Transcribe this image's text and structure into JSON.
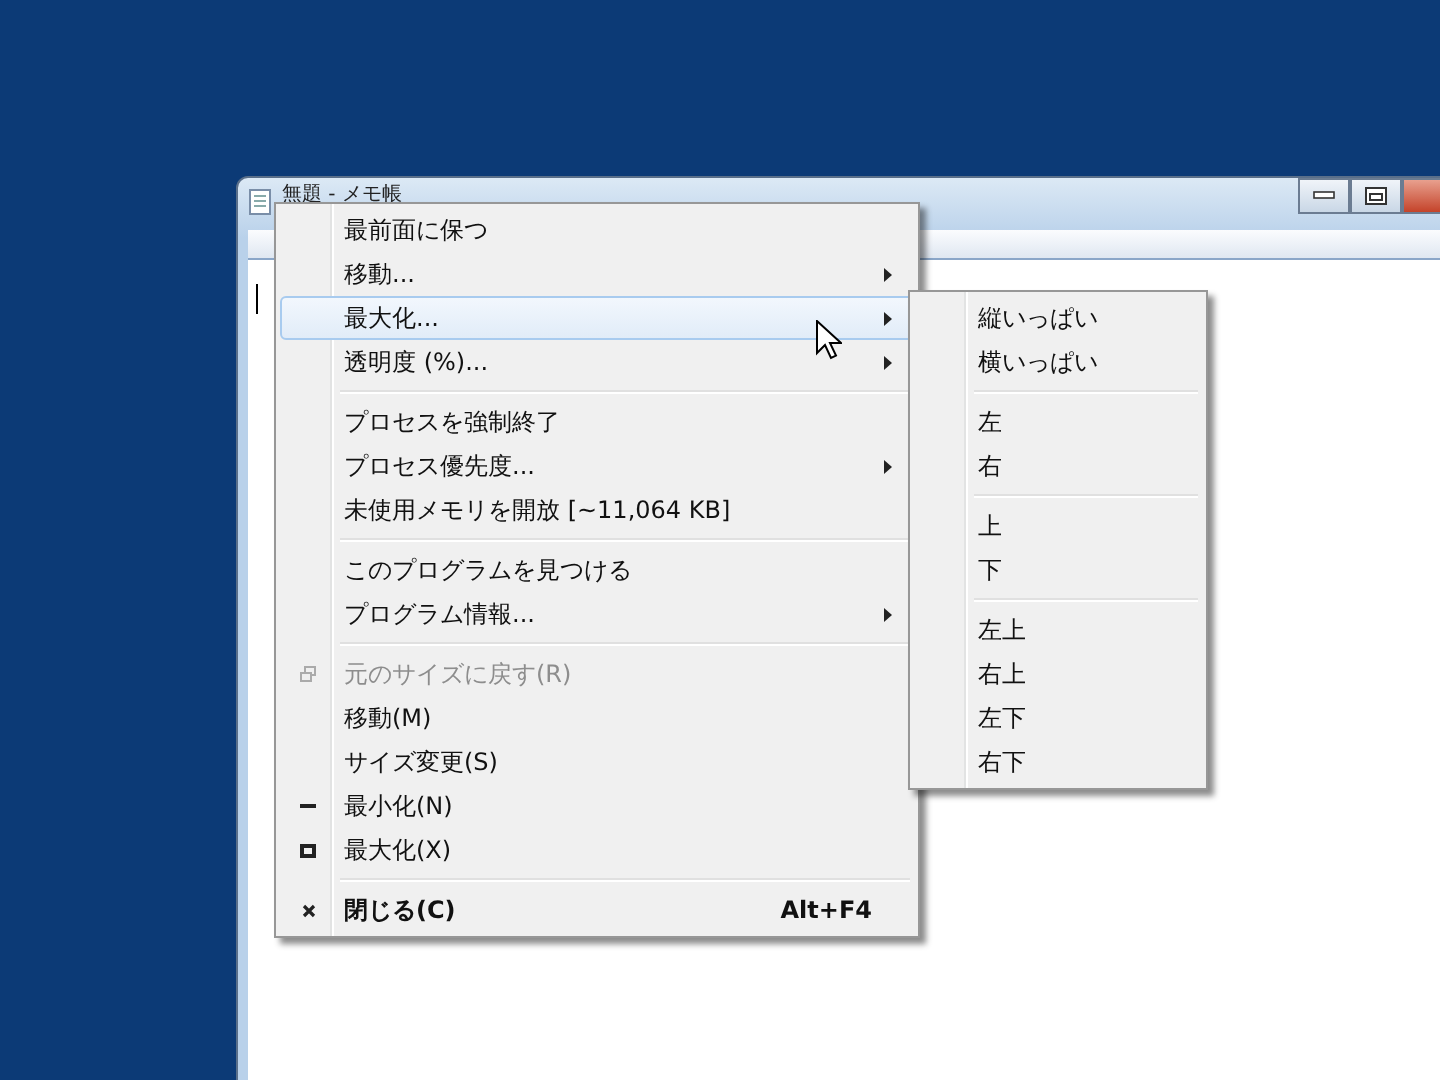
{
  "window": {
    "title": "無題 - メモ帳"
  },
  "menu": {
    "items": [
      {
        "kind": "item",
        "label": "最前面に保つ",
        "submenu": false,
        "selected": false,
        "disabled": false
      },
      {
        "kind": "item",
        "label": "移動...",
        "submenu": true,
        "selected": false,
        "disabled": false
      },
      {
        "kind": "item",
        "label": "最大化...",
        "submenu": true,
        "selected": true,
        "disabled": false
      },
      {
        "kind": "item",
        "label": "透明度 (%)...",
        "submenu": true,
        "selected": false,
        "disabled": false
      },
      {
        "kind": "separator"
      },
      {
        "kind": "item",
        "label": "プロセスを強制終了",
        "submenu": false,
        "selected": false,
        "disabled": false
      },
      {
        "kind": "item",
        "label": "プロセス優先度...",
        "submenu": true,
        "selected": false,
        "disabled": false
      },
      {
        "kind": "item",
        "label": "未使用メモリを開放 [~11,064 KB]",
        "submenu": false,
        "selected": false,
        "disabled": false
      },
      {
        "kind": "separator"
      },
      {
        "kind": "item",
        "label": "このプログラムを見つける",
        "submenu": false,
        "selected": false,
        "disabled": false
      },
      {
        "kind": "item",
        "label": "プログラム情報...",
        "submenu": true,
        "selected": false,
        "disabled": false
      },
      {
        "kind": "separator"
      },
      {
        "kind": "restore",
        "label": "元のサイズに戻す(R)",
        "submenu": false,
        "selected": false,
        "disabled": true
      },
      {
        "kind": "item",
        "label": "移動(M)",
        "submenu": false,
        "selected": false,
        "disabled": false
      },
      {
        "kind": "item",
        "label": "サイズ変更(S)",
        "submenu": false,
        "selected": false,
        "disabled": false
      },
      {
        "kind": "minimize",
        "label": "最小化(N)",
        "submenu": false,
        "selected": false,
        "disabled": false
      },
      {
        "kind": "maximize",
        "label": "最大化(X)",
        "submenu": false,
        "selected": false,
        "disabled": false
      },
      {
        "kind": "separator"
      },
      {
        "kind": "close",
        "label": "閉じる(C)",
        "shortcut": "Alt+F4",
        "default": true,
        "submenu": false,
        "selected": false,
        "disabled": false
      }
    ]
  },
  "submenu": {
    "items": [
      {
        "kind": "item",
        "label": "縦いっぱい"
      },
      {
        "kind": "item",
        "label": "横いっぱい"
      },
      {
        "kind": "separator"
      },
      {
        "kind": "item",
        "label": "左"
      },
      {
        "kind": "item",
        "label": "右"
      },
      {
        "kind": "separator"
      },
      {
        "kind": "item",
        "label": "上"
      },
      {
        "kind": "item",
        "label": "下"
      },
      {
        "kind": "separator"
      },
      {
        "kind": "item",
        "label": "左上"
      },
      {
        "kind": "item",
        "label": "右上"
      },
      {
        "kind": "item",
        "label": "左下"
      },
      {
        "kind": "item",
        "label": "右下"
      }
    ]
  }
}
